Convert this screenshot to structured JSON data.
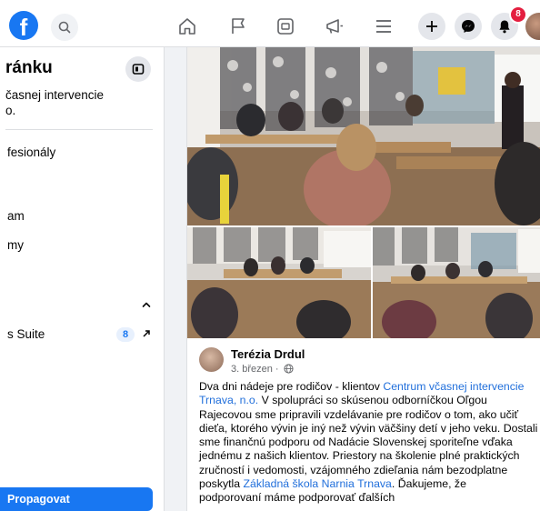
{
  "topbar": {
    "logo": "f",
    "notifications_count": "8",
    "icons": [
      "search-icon",
      "home-icon",
      "flag-icon",
      "video-icon",
      "megaphone-icon",
      "menu-icon",
      "plus-icon",
      "messenger-icon",
      "bell-icon"
    ]
  },
  "sidebar": {
    "title": "ránku",
    "subtitle_line1": "časnej intervencie",
    "subtitle_line2": "o.",
    "items": [
      {
        "label": "fesionály"
      },
      {
        "label": "am"
      },
      {
        "label": "my"
      }
    ],
    "business_suite": {
      "label": "s Suite",
      "count": "8"
    },
    "cta_label": "Propagovat"
  },
  "post": {
    "author": "Terézia Drdul",
    "date": "3. březen ·",
    "text": {
      "p1_before": "Dva dni nádeje pre rodičov - klientov ",
      "p1_link": "Centrum včasnej intervencie Trnava, n.o.",
      "p1_after": " V spolupráci so skúsenou odborníčkou Oľgou Rajecovou sme pripravili vzdelávanie pre rodičov o tom, ako učiť dieťa, ktorého vývin je iný než vývin väčšiny detí  v jeho veku. Dostali sme finančnú podporu od Nadácie Slovenskej sporiteľne vďaka jednému z našich klientov. Priestory na školenie plné praktických",
      "p2_before": " zručností i vedomosti, vzájomného zdieľania nám bezodplatne poskytla ",
      "p2_link": "Základná škola Narnia Trnava",
      "p2_after": ". Ďakujeme, že",
      "p3": "podporovaní máme podporovať ďalších"
    }
  },
  "colors": {
    "brand": "#1877f2",
    "link": "#216fdb",
    "badge": "#e41e3f"
  }
}
